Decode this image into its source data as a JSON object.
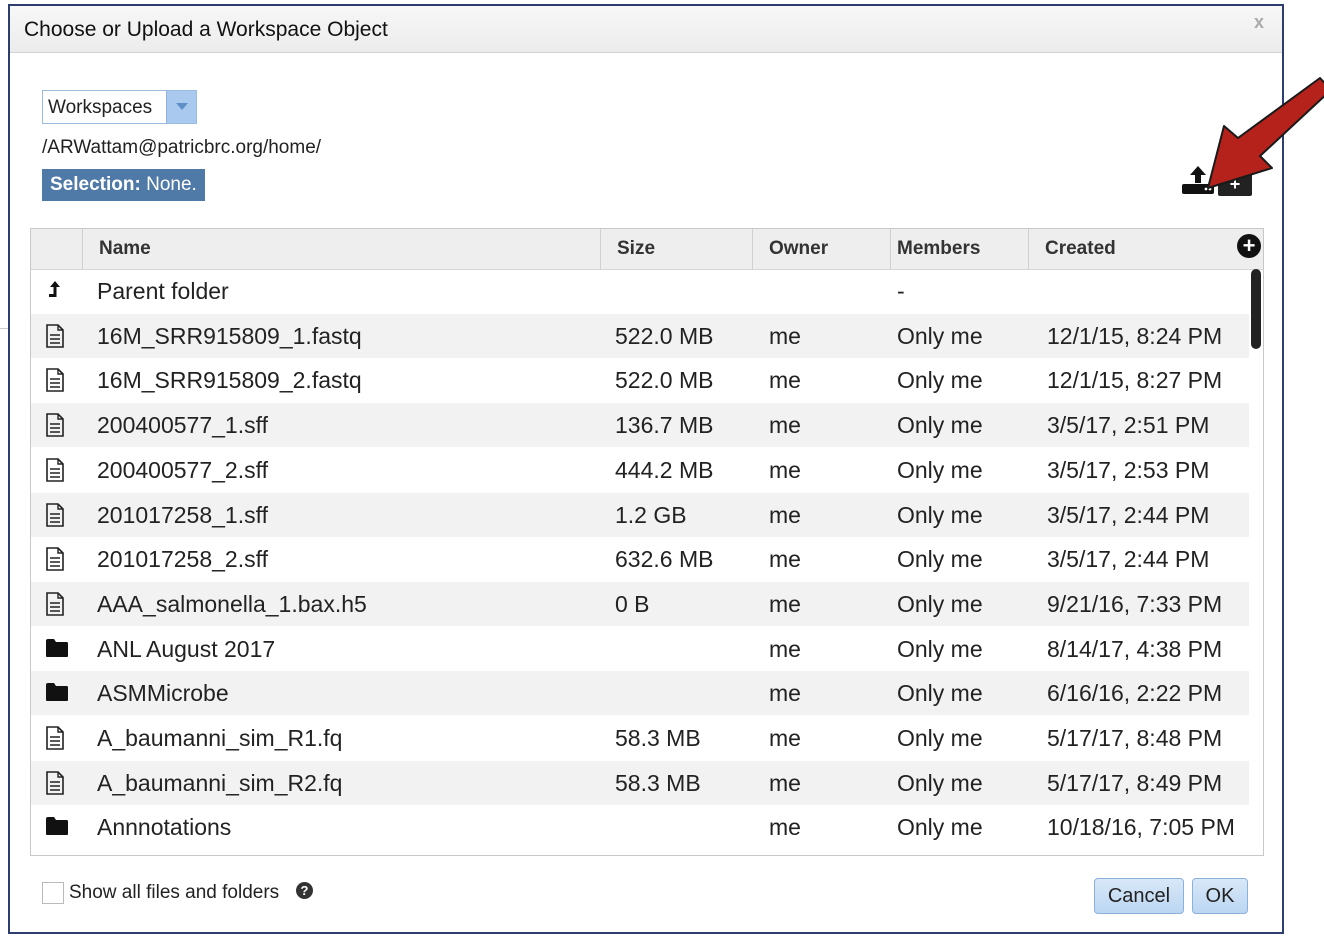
{
  "dialog": {
    "title": "Choose or Upload a Workspace Object",
    "close": "x"
  },
  "workspace_select": {
    "value": "Workspaces"
  },
  "path": "/ARWattam@patricbrc.org/home/",
  "selection": {
    "label": "Selection:",
    "value": "None."
  },
  "toolbar": {
    "upload_icon": "upload-icon",
    "new_folder_icon": "add-folder-icon",
    "new_folder_glyph": "+"
  },
  "annotation": {
    "arrow_color": "#b5221b"
  },
  "grid": {
    "columns": [
      "Name",
      "Size",
      "Owner",
      "Members",
      "Created"
    ],
    "add_column": "+",
    "rows": [
      {
        "icon": "parent-folder-icon",
        "name": "Parent folder",
        "size": "",
        "owner": "",
        "members": "-",
        "created": ""
      },
      {
        "icon": "file-icon",
        "name": "16M_SRR915809_1.fastq",
        "size": "522.0 MB",
        "owner": "me",
        "members": "Only me",
        "created": "12/1/15, 8:24 PM"
      },
      {
        "icon": "file-icon",
        "name": "16M_SRR915809_2.fastq",
        "size": "522.0 MB",
        "owner": "me",
        "members": "Only me",
        "created": "12/1/15, 8:27 PM"
      },
      {
        "icon": "file-icon",
        "name": "200400577_1.sff",
        "size": "136.7 MB",
        "owner": "me",
        "members": "Only me",
        "created": "3/5/17, 2:51 PM"
      },
      {
        "icon": "file-icon",
        "name": "200400577_2.sff",
        "size": "444.2 MB",
        "owner": "me",
        "members": "Only me",
        "created": "3/5/17, 2:53 PM"
      },
      {
        "icon": "file-icon",
        "name": "201017258_1.sff",
        "size": "1.2 GB",
        "owner": "me",
        "members": "Only me",
        "created": "3/5/17, 2:44 PM"
      },
      {
        "icon": "file-icon",
        "name": "201017258_2.sff",
        "size": "632.6 MB",
        "owner": "me",
        "members": "Only me",
        "created": "3/5/17, 2:44 PM"
      },
      {
        "icon": "file-icon",
        "name": "AAA_salmonella_1.bax.h5",
        "size": "0 B",
        "owner": "me",
        "members": "Only me",
        "created": "9/21/16, 7:33 PM"
      },
      {
        "icon": "folder-icon",
        "name": "ANL August 2017",
        "size": "",
        "owner": "me",
        "members": "Only me",
        "created": "8/14/17, 4:38 PM"
      },
      {
        "icon": "folder-icon",
        "name": "ASMMicrobe",
        "size": "",
        "owner": "me",
        "members": "Only me",
        "created": "6/16/16, 2:22 PM"
      },
      {
        "icon": "file-icon",
        "name": "A_baumanni_sim_R1.fq",
        "size": "58.3 MB",
        "owner": "me",
        "members": "Only me",
        "created": "5/17/17, 8:48 PM"
      },
      {
        "icon": "file-icon",
        "name": "A_baumanni_sim_R2.fq",
        "size": "58.3 MB",
        "owner": "me",
        "members": "Only me",
        "created": "5/17/17, 8:49 PM"
      },
      {
        "icon": "folder-icon",
        "name": "Annnotations",
        "size": "",
        "owner": "me",
        "members": "Only me",
        "created": "10/18/16, 7:05 PM"
      }
    ]
  },
  "footer": {
    "show_all_label": "Show all files and folders",
    "help": "?",
    "cancel": "Cancel",
    "ok": "OK"
  }
}
